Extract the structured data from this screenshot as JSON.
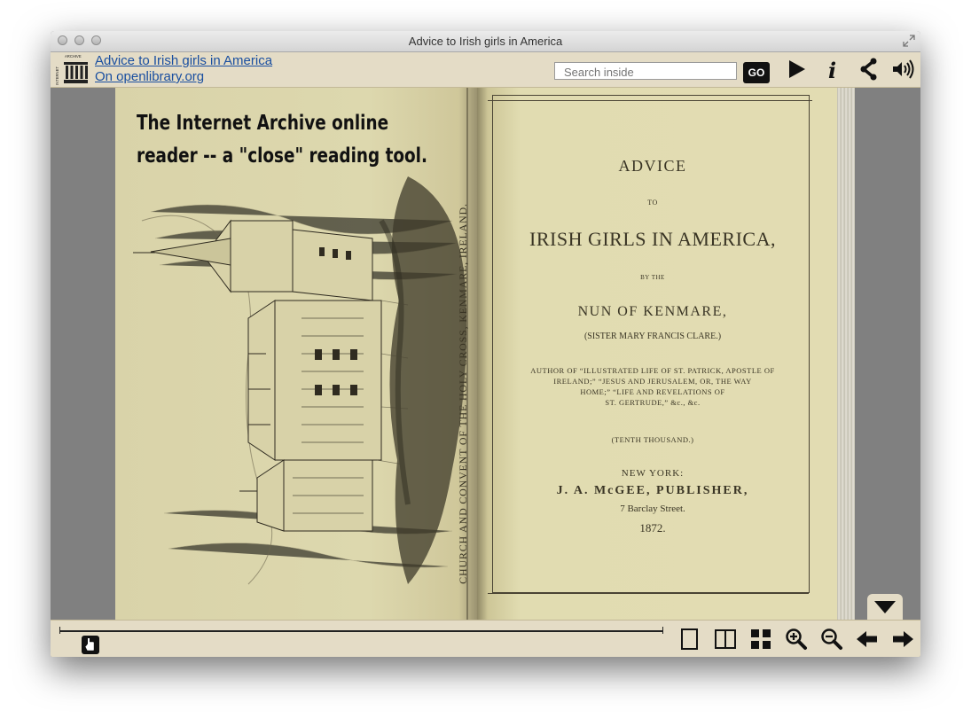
{
  "window": {
    "title": "Advice to Irish girls in America"
  },
  "header": {
    "book_link": "Advice to Irish girls in America",
    "library_link": "On openlibrary.org",
    "search": {
      "placeholder": "Search inside",
      "value": ""
    },
    "go_label": "GO",
    "icons": [
      "play-icon",
      "info-icon",
      "share-icon",
      "audio-icon"
    ]
  },
  "logo": {
    "text": "INTERNET ARCHIVE",
    "icon": "archive-temple-icon"
  },
  "overlay": {
    "line1": "The Internet Archive online",
    "line2": "reader -- a \"close\" reading tool."
  },
  "left_page": {
    "caption": "CHURCH AND CONVENT OF THE HOLY CROSS, KENMARE, IRELAND."
  },
  "title_page": {
    "l1": "ADVICE",
    "l2": "TO",
    "l3": "IRISH GIRLS IN AMERICA,",
    "l4": "BY THE",
    "l5": "NUN OF KENMARE,",
    "l6": "(SISTER MARY FRANCIS CLARE.)",
    "l7": "AUTHOR OF “ILLUSTRATED LIFE OF ST. PATRICK, APOSTLE OF",
    "l8": "IRELAND;” “JESUS AND JERUSALEM, OR, THE WAY",
    "l9": "HOME;” “LIFE AND REVELATIONS OF",
    "l10": "ST. GERTRUDE,” &c., &c.",
    "l11": "(TENTH THOUSAND.)",
    "l12": "NEW YORK:",
    "l13": "J. A. McGEE, PUBLISHER,",
    "l14": "7 Barclay Street.",
    "l15": "1872."
  },
  "toolbar": {
    "page_progress": 0.04,
    "icons": [
      "one-page-view-icon",
      "two-page-view-icon",
      "thumbnail-view-icon",
      "zoom-in-icon",
      "zoom-out-icon",
      "previous-page-icon",
      "next-page-icon"
    ],
    "collapse_icon": "collapse-toolbar-icon"
  },
  "colors": {
    "chrome": "#e4dcc6",
    "link": "#1a4fa0",
    "page": "#e2dcb2",
    "ink": "#3a3525"
  }
}
